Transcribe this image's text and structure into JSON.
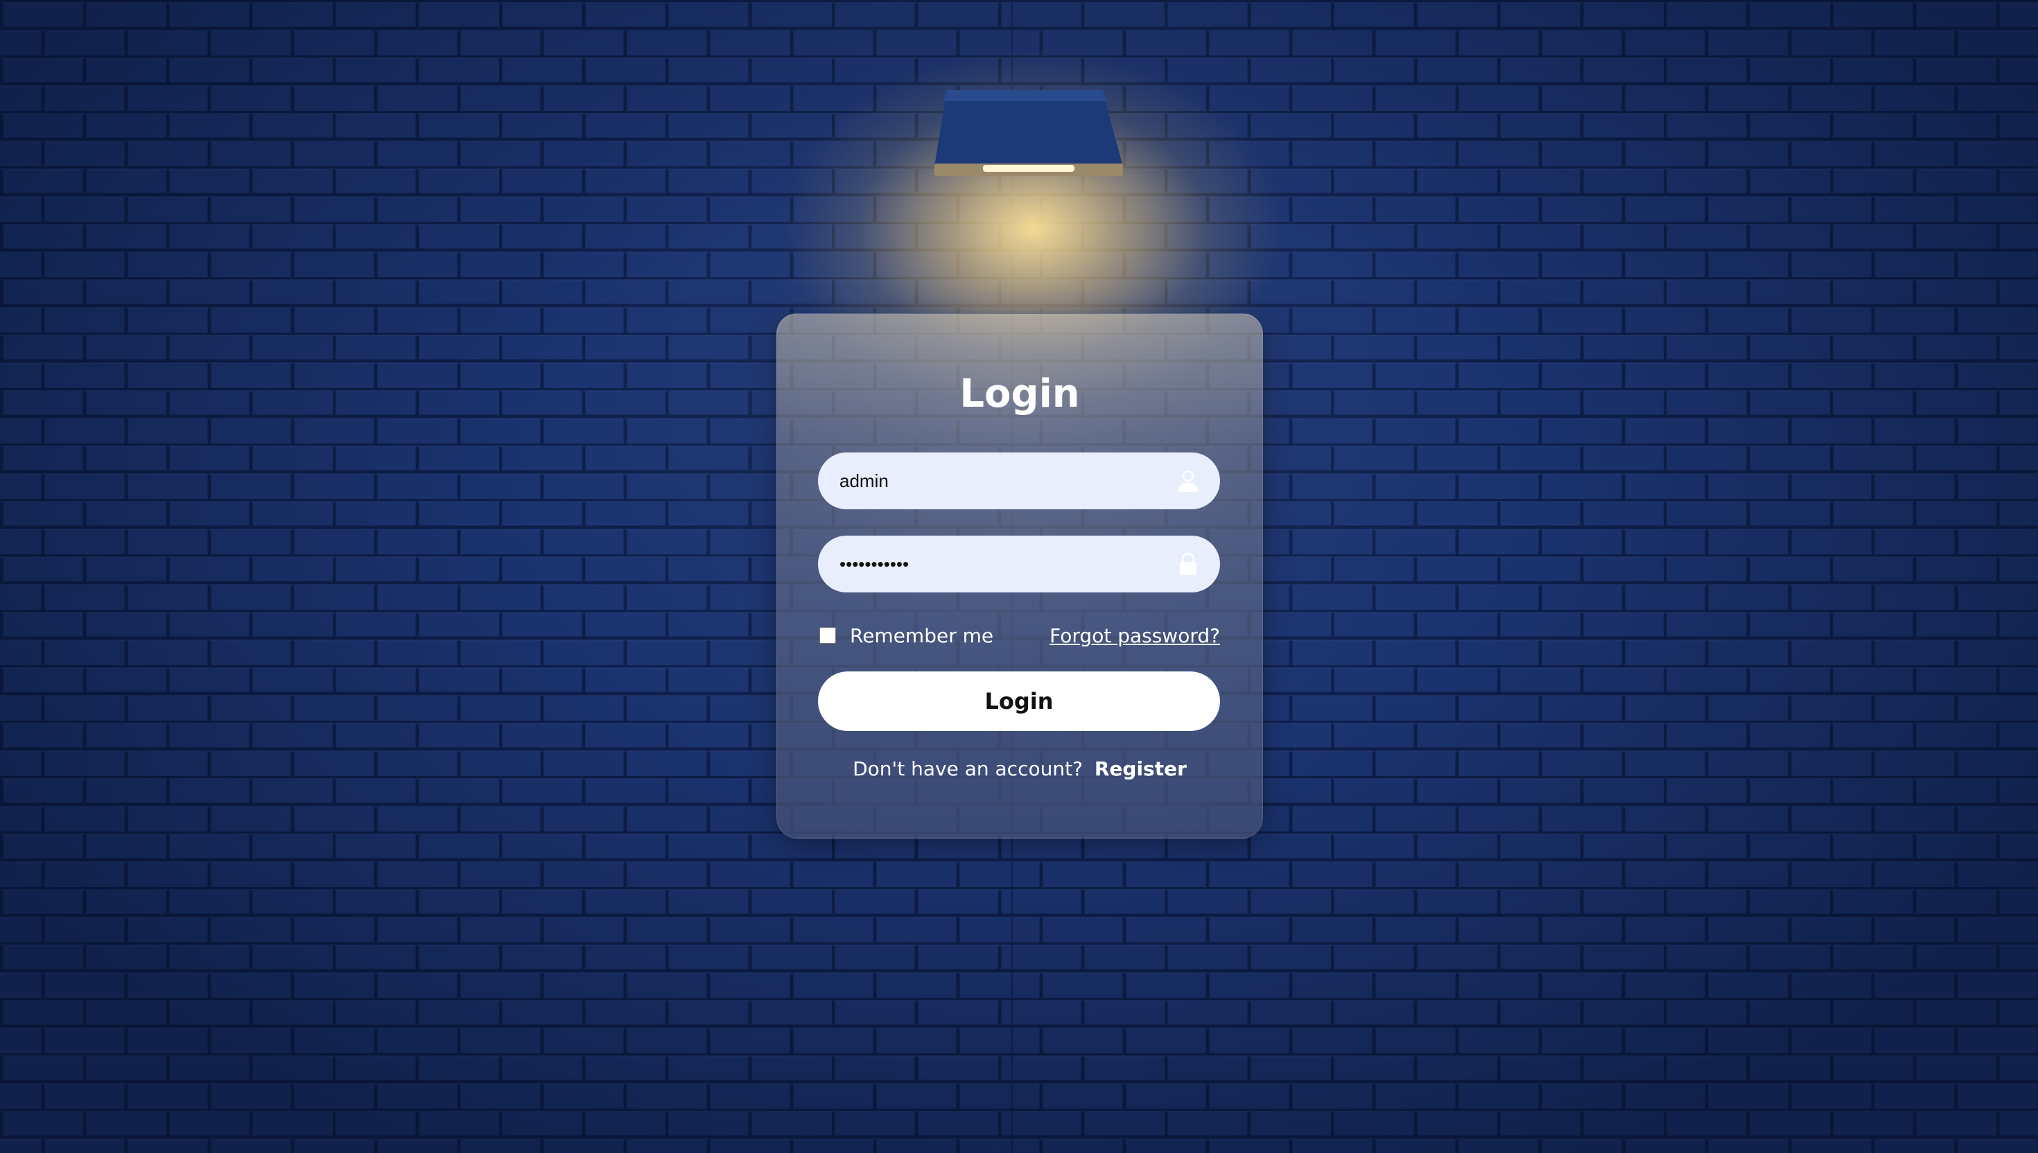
{
  "login_form": {
    "title": "Login",
    "username": {
      "value": "admin",
      "icon": "user-icon"
    },
    "password": {
      "value": "•••••••••••",
      "icon": "lock-icon"
    },
    "remember_label": "Remember me",
    "remember_checked": false,
    "forgot_label": "Forgot password?",
    "submit_label": "Login",
    "signup_prompt": "Don't have an account?",
    "register_label": "Register"
  },
  "colors": {
    "wall": "#13295c",
    "lamp_light": "#ffe29a",
    "input_bg": "#e8eefc",
    "button_bg": "#ffffff"
  }
}
